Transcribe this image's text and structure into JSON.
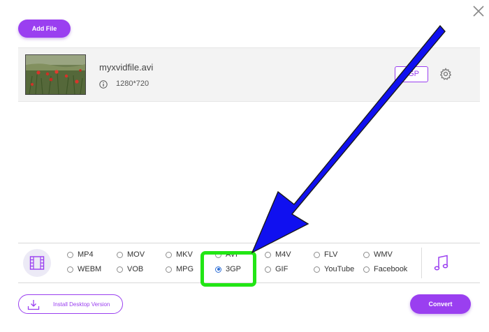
{
  "toolbar": {
    "add_file_label": "Add File"
  },
  "file": {
    "name": "myxvidfile.avi",
    "resolution": "1280*720",
    "output_format": "3GP"
  },
  "formats": {
    "video_options": [
      {
        "label": "MP4",
        "checked": false
      },
      {
        "label": "MOV",
        "checked": false
      },
      {
        "label": "MKV",
        "checked": false
      },
      {
        "label": "AVI",
        "checked": false
      },
      {
        "label": "M4V",
        "checked": false
      },
      {
        "label": "FLV",
        "checked": false
      },
      {
        "label": "WMV",
        "checked": false
      },
      {
        "label": "WEBM",
        "checked": false
      },
      {
        "label": "VOB",
        "checked": false
      },
      {
        "label": "MPG",
        "checked": false
      },
      {
        "label": "3GP",
        "checked": true
      },
      {
        "label": "GIF",
        "checked": false
      },
      {
        "label": "YouTube",
        "checked": false
      },
      {
        "label": "Facebook",
        "checked": false
      }
    ]
  },
  "footer": {
    "install_label": "Install Desktop Version",
    "convert_label": "Convert"
  },
  "colors": {
    "accent": "#9a3ff0",
    "highlight": "#22e615",
    "arrow": "#1010f0"
  }
}
